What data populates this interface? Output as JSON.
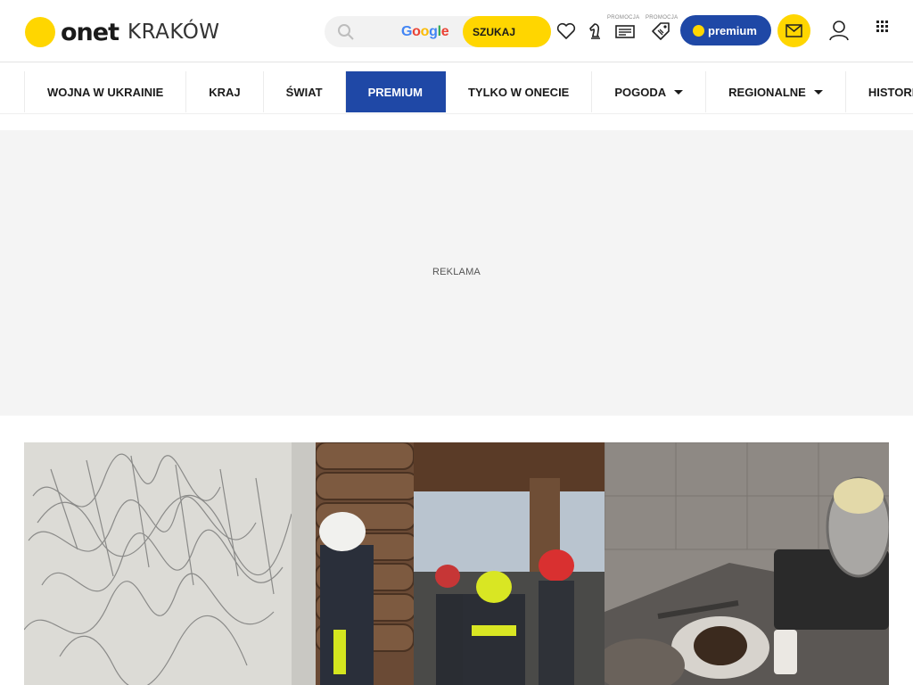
{
  "brand": {
    "name": "onet",
    "city": "KRAKÓW",
    "accent_color": "#ffd600",
    "premium_color": "#1f48a6"
  },
  "search": {
    "engine_label": "Google",
    "button_label": "SZUKAJ",
    "icon": "search-icon"
  },
  "header_icons": {
    "favorites": "heart-icon",
    "chess": "chess-knight-icon",
    "promo_1_label": "PROMOCJA",
    "promo_1_icon": "receipt-icon",
    "promo_2_label": "PROMOCJA",
    "promo_2_icon": "tag-icon",
    "mail": "mail-icon",
    "user": "user-icon",
    "apps": "apps-grid-icon"
  },
  "premium_button": {
    "label": "premium"
  },
  "nav": {
    "items": [
      {
        "label": "WOJNA W UKRAINIE"
      },
      {
        "label": "KRAJ"
      },
      {
        "label": "ŚWIAT"
      },
      {
        "label": "PREMIUM"
      },
      {
        "label": "TYLKO W ONECIE"
      },
      {
        "label": "POGODA"
      },
      {
        "label": "REGIONALNE"
      },
      {
        "label": "HISTORIA"
      }
    ]
  },
  "ad": {
    "label": "REKLAMA"
  },
  "hero": {
    "panels": [
      "pencil-scribbles-photo",
      "firefighters-photo",
      "burnt-kitchen-photo"
    ]
  }
}
